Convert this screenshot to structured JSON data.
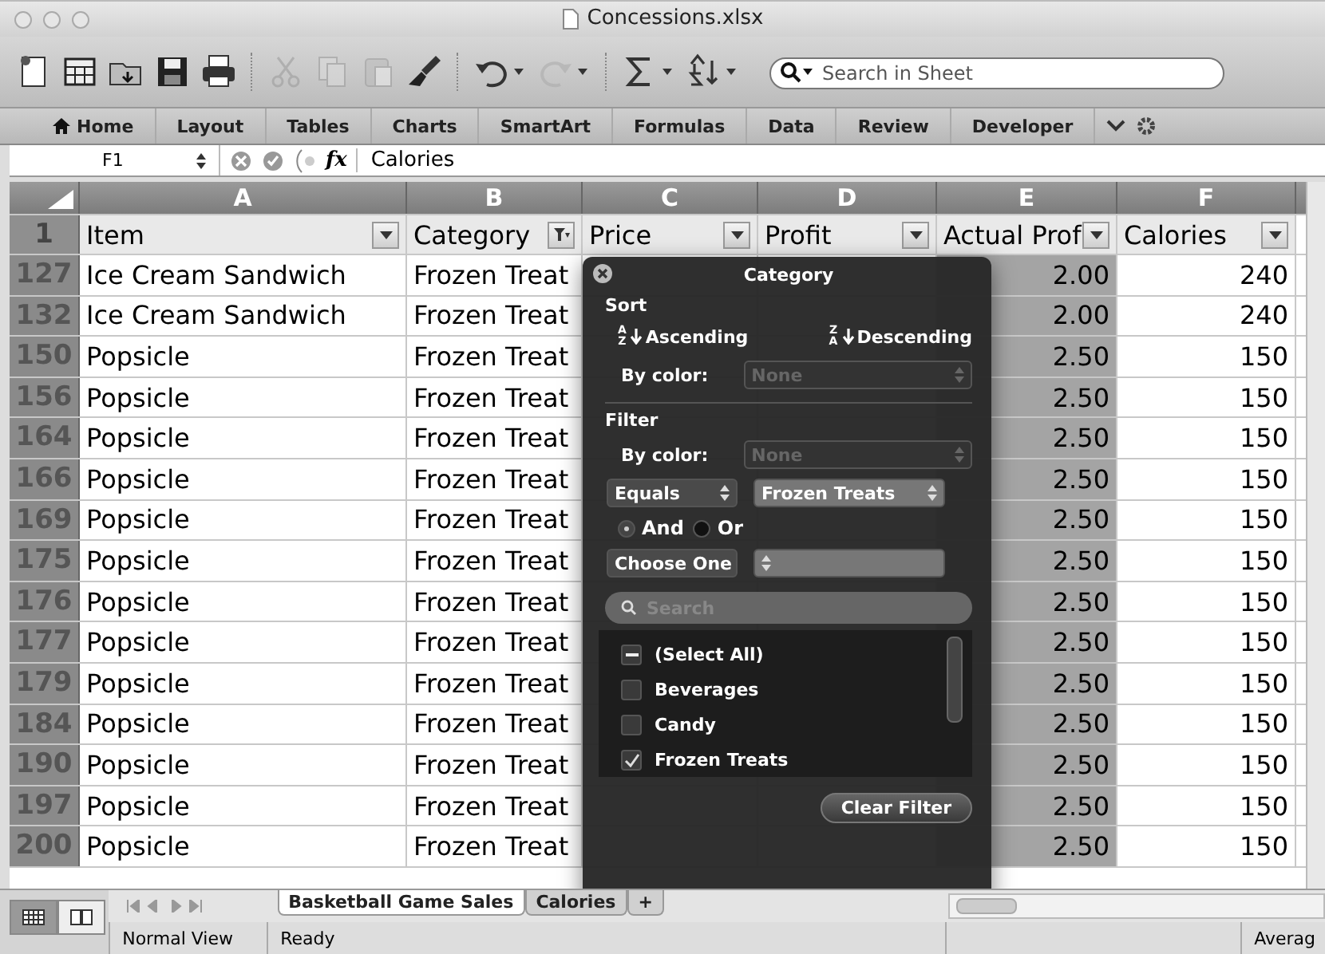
{
  "window": {
    "title": "Concessions.xlsx"
  },
  "toolbar": {
    "search_placeholder": "Search in Sheet"
  },
  "ribbon": {
    "tabs": [
      {
        "label": "Home"
      },
      {
        "label": "Layout"
      },
      {
        "label": "Tables"
      },
      {
        "label": "Charts"
      },
      {
        "label": "SmartArt"
      },
      {
        "label": "Formulas"
      },
      {
        "label": "Data"
      },
      {
        "label": "Review"
      },
      {
        "label": "Developer"
      }
    ]
  },
  "formula_bar": {
    "cell_ref": "F1",
    "fx": "fx",
    "value": "Calories"
  },
  "sheet": {
    "columns": [
      "A",
      "B",
      "C",
      "D",
      "E",
      "F"
    ],
    "header_row": {
      "number": "1",
      "cells": [
        {
          "text": "Item",
          "filtered": false
        },
        {
          "text": "Category",
          "filtered": true
        },
        {
          "text": "Price",
          "filtered": false
        },
        {
          "text": "Profit",
          "filtered": false
        },
        {
          "text": "Actual Prof",
          "filtered": false
        },
        {
          "text": "Calories",
          "filtered": false
        }
      ]
    },
    "rows": [
      {
        "number": "127",
        "item": "Ice Cream Sandwich",
        "category": "Frozen Treat",
        "actual_profit": "2.00",
        "calories": "240"
      },
      {
        "number": "132",
        "item": "Ice Cream Sandwich",
        "category": "Frozen Treat",
        "actual_profit": "2.00",
        "calories": "240"
      },
      {
        "number": "150",
        "item": "Popsicle",
        "category": "Frozen Treat",
        "actual_profit": "2.50",
        "calories": "150"
      },
      {
        "number": "156",
        "item": "Popsicle",
        "category": "Frozen Treat",
        "actual_profit": "2.50",
        "calories": "150"
      },
      {
        "number": "164",
        "item": "Popsicle",
        "category": "Frozen Treat",
        "actual_profit": "2.50",
        "calories": "150"
      },
      {
        "number": "166",
        "item": "Popsicle",
        "category": "Frozen Treat",
        "actual_profit": "2.50",
        "calories": "150"
      },
      {
        "number": "169",
        "item": "Popsicle",
        "category": "Frozen Treat",
        "actual_profit": "2.50",
        "calories": "150"
      },
      {
        "number": "175",
        "item": "Popsicle",
        "category": "Frozen Treat",
        "actual_profit": "2.50",
        "calories": "150"
      },
      {
        "number": "176",
        "item": "Popsicle",
        "category": "Frozen Treat",
        "actual_profit": "2.50",
        "calories": "150"
      },
      {
        "number": "177",
        "item": "Popsicle",
        "category": "Frozen Treat",
        "actual_profit": "2.50",
        "calories": "150"
      },
      {
        "number": "179",
        "item": "Popsicle",
        "category": "Frozen Treat",
        "actual_profit": "2.50",
        "calories": "150"
      },
      {
        "number": "184",
        "item": "Popsicle",
        "category": "Frozen Treat",
        "actual_profit": "2.50",
        "calories": "150"
      },
      {
        "number": "190",
        "item": "Popsicle",
        "category": "Frozen Treat",
        "actual_profit": "2.50",
        "calories": "150"
      },
      {
        "number": "197",
        "item": "Popsicle",
        "category": "Frozen Treat",
        "actual_profit": "2.50",
        "calories": "150"
      },
      {
        "number": "200",
        "item": "Popsicle",
        "category": "Frozen Treat",
        "actual_profit": "2.50",
        "calories": "150"
      }
    ]
  },
  "filter_popup": {
    "title": "Category",
    "sort_heading": "Sort",
    "sort_options": [
      {
        "label": "Ascending",
        "top": "A",
        "bottom": "Z"
      },
      {
        "label": "Descending",
        "top": "Z",
        "bottom": "A"
      }
    ],
    "sort_by_color": {
      "label": "By color:",
      "value": "None"
    },
    "filter_heading": "Filter",
    "filter_by_color": {
      "label": "By color:",
      "value": "None"
    },
    "condition1": {
      "operator": "Equals",
      "value": "Frozen Treats"
    },
    "joins": [
      {
        "label": "And",
        "selected": true
      },
      {
        "label": "Or",
        "selected": false
      }
    ],
    "condition2": {
      "operator": "Choose One"
    },
    "search_placeholder": "Search",
    "items": [
      {
        "label": "(Select All)",
        "checked": false,
        "partial": true
      },
      {
        "label": "Beverages",
        "checked": false,
        "partial": false
      },
      {
        "label": "Candy",
        "checked": false,
        "partial": false
      },
      {
        "label": "Frozen Treats",
        "checked": true,
        "partial": false
      }
    ],
    "clear_button": "Clear Filter"
  },
  "sheet_tabs": [
    {
      "label": "Basketball Game Sales",
      "selected": true
    },
    {
      "label": "Calories",
      "selected": false
    },
    {
      "label": "+",
      "selected": false
    }
  ],
  "status_bar": {
    "view": "Normal View",
    "status": "Ready",
    "summary": "Averag"
  }
}
